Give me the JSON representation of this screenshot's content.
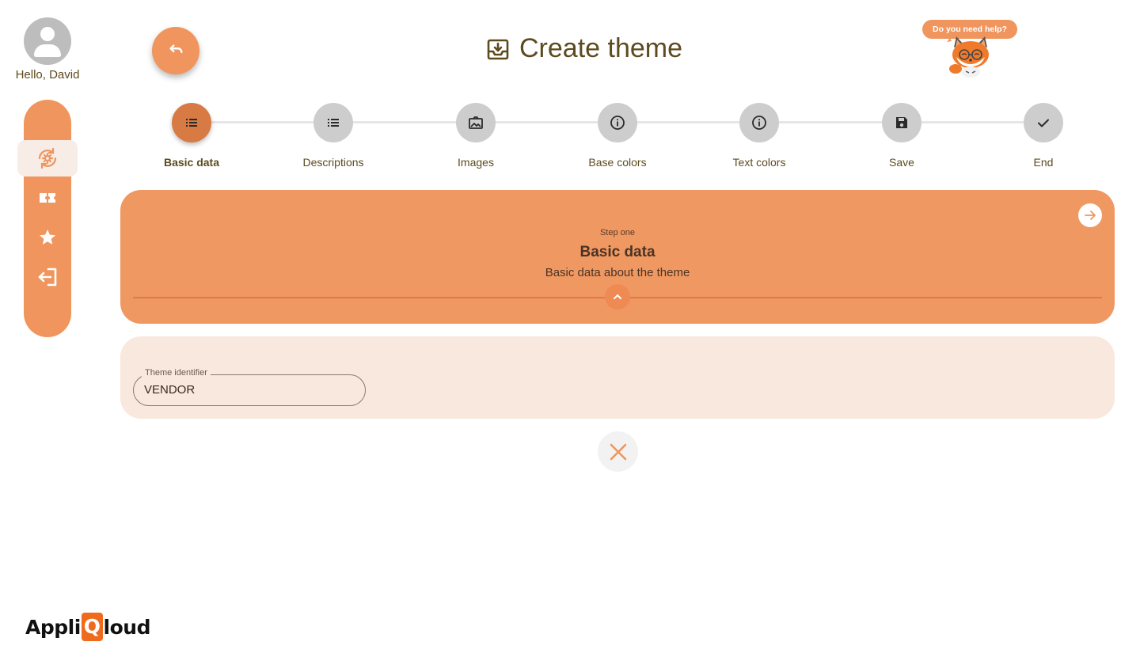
{
  "user": {
    "greeting": "Hello, David"
  },
  "sidebar": {
    "items": [
      {
        "icon": "settings-sync-icon",
        "active": true
      },
      {
        "icon": "ticket-icon",
        "active": false
      },
      {
        "icon": "star-icon",
        "active": false
      },
      {
        "icon": "logout-icon",
        "active": false
      }
    ]
  },
  "header": {
    "title": "Create theme",
    "title_icon": "download-box-icon",
    "back_icon": "undo-icon"
  },
  "help": {
    "bubble_text": "Do you need help?",
    "mascot": "fox-mascot"
  },
  "stepper": {
    "steps": [
      {
        "label": "Basic data",
        "icon": "list-icon",
        "active": true
      },
      {
        "label": "Descriptions",
        "icon": "list-icon",
        "active": false
      },
      {
        "label": "Images",
        "icon": "image-icon",
        "active": false
      },
      {
        "label": "Base colors",
        "icon": "info-icon",
        "active": false
      },
      {
        "label": "Text colors",
        "icon": "info-icon",
        "active": false
      },
      {
        "label": "Save",
        "icon": "save-icon",
        "active": false
      },
      {
        "label": "End",
        "icon": "check-icon",
        "active": false
      }
    ]
  },
  "step_card": {
    "subtitle": "Step one",
    "title": "Basic data",
    "description": "Basic data about the theme"
  },
  "form": {
    "theme_identifier": {
      "label": "Theme identifier",
      "value": "VENDOR"
    }
  },
  "logo": {
    "part1": "Appli",
    "part2": "Q",
    "part3": "loud"
  },
  "colors": {
    "accent": "#f0955d",
    "accent_dark": "#d87a43",
    "form_bg": "#f9e8de",
    "text_brown": "#5d4a1e",
    "step_inactive": "#cdcdcd"
  }
}
